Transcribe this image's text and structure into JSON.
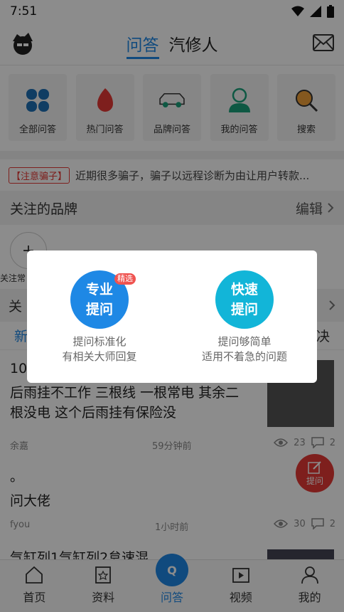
{
  "status": {
    "time": "7:51"
  },
  "header": {
    "tab_active": "问答",
    "tab_other": "汽修人"
  },
  "categories": [
    {
      "label": "全部问答",
      "icon": "clover-icon"
    },
    {
      "label": "热门问答",
      "icon": "fire-icon"
    },
    {
      "label": "品牌问答",
      "icon": "car-icon"
    },
    {
      "label": "我的问答",
      "icon": "person-icon"
    },
    {
      "label": "搜索",
      "icon": "search-icon"
    }
  ],
  "notice": {
    "tag": "【注意骗子】",
    "text": "近期很多骗子，骗子以远程诊断为由让用户转款..."
  },
  "brands": {
    "title": "关注的品牌",
    "edit": "编辑",
    "add_label": "关注常"
  },
  "section2": {
    "title": "关",
    "right": ""
  },
  "sort": {
    "active": "新",
    "right": "决"
  },
  "posts": [
    {
      "title": "10",
      "title2": "后雨挂不工作 三根线 一根常电 其余二根没电 这个后雨挂有保险没",
      "user": "余嘉",
      "time": "59分钟前",
      "views": "23",
      "comments": "2"
    },
    {
      "title": "。",
      "title2": "问大佬",
      "user": "fyou",
      "time": "1小时前",
      "views": "30",
      "comments": "2"
    },
    {
      "title": "气缸列1气缸列2怠速混",
      "title2": ""
    }
  ],
  "fab": {
    "label": "提问"
  },
  "bottom_nav": [
    {
      "label": "首页"
    },
    {
      "label": "资料"
    },
    {
      "label": "问答"
    },
    {
      "label": "视频"
    },
    {
      "label": "我的"
    }
  ],
  "modal": {
    "pro": {
      "line1": "专业",
      "line2": "提问",
      "badge": "精选",
      "desc1": "提问标准化",
      "desc2": "有相关大师回复",
      "color": "#1e88e5"
    },
    "quick": {
      "line1": "快速",
      "line2": "提问",
      "desc1": "提问够简单",
      "desc2": "适用不着急的问题",
      "color": "#12b5d8"
    }
  }
}
